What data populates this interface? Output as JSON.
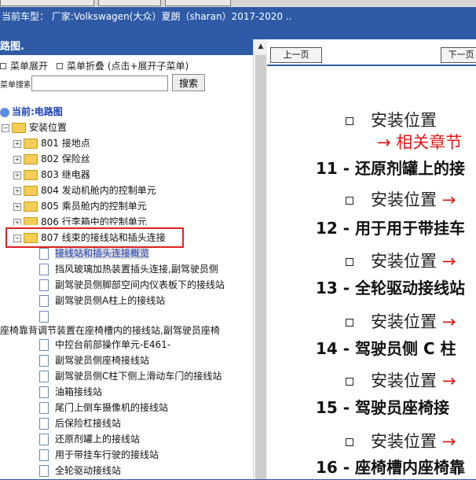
{
  "vehicle_bar": {
    "text": "当前车型：  厂家:Volkswagen(大众）夏朗（sharan）2017-2020  .."
  },
  "left_panel": {
    "title": "路图.",
    "expand_label": "菜单展开",
    "collapse_label": "菜单折叠 (点击+展开子菜单)",
    "search_label": "菜单搜索",
    "search_value": "",
    "search_button": "搜索",
    "current_label": "当前:电路图",
    "install_location": "安装位置",
    "folders": [
      "801 接地点",
      "802 保险丝",
      "803 继电器",
      "804 发动机舱内的控制单元",
      "805 乘员舱内的控制单元",
      "806 行李箱中的控制单元"
    ],
    "folder_open": "807 线束的接线站和插头连接",
    "docs": [
      "接线站和插头连接概览",
      "挡风玻璃加热装置插头连接,副驾驶员侧",
      "副驾驶员侧脚部空间内仪表板下的接线站",
      "副驾驶员侧A柱上的接线站",
      "",
      "座椅靠背调节装置在座椅槽内的接线站,副驾驶员座椅",
      "中控台前部操作单元-E461-",
      "副驾驶员侧座椅接线站",
      "副驾驶员侧C柱下侧上滑动车门的接线站",
      "油箱接线站",
      "尾门上倒车摄像机的接线站",
      "后保险杠接线站",
      "还原剂罐上的接线站",
      "用于带挂车行驶的接线站",
      "全轮驱动接线站"
    ]
  },
  "right_panel": {
    "prev_button": "上一页",
    "next_button": "下一页",
    "bullet_text": "安装位置",
    "related_text": "→ 相关章节",
    "arrow": "→",
    "headings": [
      "11 - 还原剂罐上的接",
      "12 - 用于用于带挂车",
      "13 - 全轮驱动接线站",
      "14 - 驾驶员侧 C 柱",
      "15 - 驾驶员座椅接",
      "16 - 座椅槽内座椅靠"
    ]
  }
}
